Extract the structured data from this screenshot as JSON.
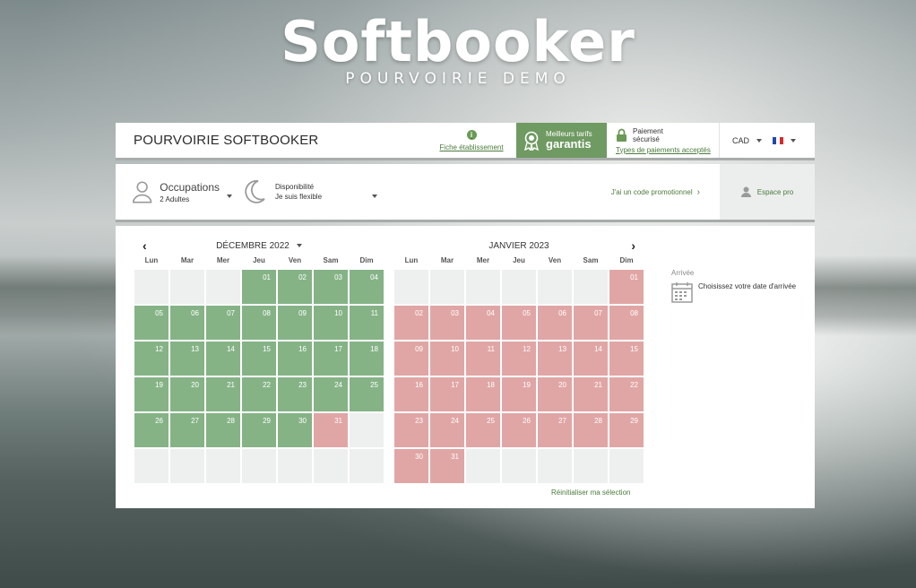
{
  "logo": {
    "title": "Softbooker",
    "subtitle": "POURVOIRIE DEMO"
  },
  "header": {
    "brand": "POURVOIRIE SOFTBOOKER",
    "fiche_link": "Fiche établissement",
    "badge_line1": "Meilleurs tarifs",
    "badge_line2": "garantis",
    "paiement_line1": "Paiement",
    "paiement_line2": "sécurisé",
    "paiement_link": "Types de paiements acceptés",
    "currency": "CAD"
  },
  "search": {
    "occupations_label": "Occupations",
    "occupations_value": "2 Adultes",
    "dispo_label": "Disponibilité",
    "dispo_value": "Je suis flexible",
    "promo_link": "J'ai un code promotionnel",
    "espace_pro": "Espace pro"
  },
  "calendar": {
    "months": [
      {
        "title": "DÉCEMBRE 2022",
        "weekdays": [
          "Lun",
          "Mar",
          "Mer",
          "Jeu",
          "Ven",
          "Sam",
          "Dim"
        ],
        "cells": [
          {
            "d": "",
            "s": "e"
          },
          {
            "d": "",
            "s": "e"
          },
          {
            "d": "",
            "s": "e"
          },
          {
            "d": "01",
            "s": "g"
          },
          {
            "d": "02",
            "s": "g"
          },
          {
            "d": "03",
            "s": "g"
          },
          {
            "d": "04",
            "s": "g"
          },
          {
            "d": "05",
            "s": "g"
          },
          {
            "d": "06",
            "s": "g"
          },
          {
            "d": "07",
            "s": "g"
          },
          {
            "d": "08",
            "s": "g"
          },
          {
            "d": "09",
            "s": "g"
          },
          {
            "d": "10",
            "s": "g"
          },
          {
            "d": "11",
            "s": "g"
          },
          {
            "d": "12",
            "s": "g"
          },
          {
            "d": "13",
            "s": "g"
          },
          {
            "d": "14",
            "s": "g"
          },
          {
            "d": "15",
            "s": "g"
          },
          {
            "d": "16",
            "s": "g"
          },
          {
            "d": "17",
            "s": "g"
          },
          {
            "d": "18",
            "s": "g"
          },
          {
            "d": "19",
            "s": "g"
          },
          {
            "d": "20",
            "s": "g"
          },
          {
            "d": "21",
            "s": "g"
          },
          {
            "d": "22",
            "s": "g"
          },
          {
            "d": "23",
            "s": "g"
          },
          {
            "d": "24",
            "s": "g"
          },
          {
            "d": "25",
            "s": "g"
          },
          {
            "d": "26",
            "s": "g"
          },
          {
            "d": "27",
            "s": "g"
          },
          {
            "d": "28",
            "s": "g"
          },
          {
            "d": "29",
            "s": "g"
          },
          {
            "d": "30",
            "s": "g"
          },
          {
            "d": "31",
            "s": "r"
          },
          {
            "d": "",
            "s": "e"
          },
          {
            "d": "",
            "s": "e"
          },
          {
            "d": "",
            "s": "e"
          },
          {
            "d": "",
            "s": "e"
          },
          {
            "d": "",
            "s": "e"
          },
          {
            "d": "",
            "s": "e"
          },
          {
            "d": "",
            "s": "e"
          },
          {
            "d": "",
            "s": "e"
          }
        ]
      },
      {
        "title": "JANVIER 2023",
        "weekdays": [
          "Lun",
          "Mar",
          "Mer",
          "Jeu",
          "Ven",
          "Sam",
          "Dim"
        ],
        "cells": [
          {
            "d": "",
            "s": "e"
          },
          {
            "d": "",
            "s": "e"
          },
          {
            "d": "",
            "s": "e"
          },
          {
            "d": "",
            "s": "e"
          },
          {
            "d": "",
            "s": "e"
          },
          {
            "d": "",
            "s": "e"
          },
          {
            "d": "01",
            "s": "r"
          },
          {
            "d": "02",
            "s": "r"
          },
          {
            "d": "03",
            "s": "r"
          },
          {
            "d": "04",
            "s": "r"
          },
          {
            "d": "05",
            "s": "r"
          },
          {
            "d": "06",
            "s": "r"
          },
          {
            "d": "07",
            "s": "r"
          },
          {
            "d": "08",
            "s": "r"
          },
          {
            "d": "09",
            "s": "r"
          },
          {
            "d": "10",
            "s": "r"
          },
          {
            "d": "11",
            "s": "r"
          },
          {
            "d": "12",
            "s": "r"
          },
          {
            "d": "13",
            "s": "r"
          },
          {
            "d": "14",
            "s": "r"
          },
          {
            "d": "15",
            "s": "r"
          },
          {
            "d": "16",
            "s": "r"
          },
          {
            "d": "17",
            "s": "r"
          },
          {
            "d": "18",
            "s": "r"
          },
          {
            "d": "19",
            "s": "r"
          },
          {
            "d": "20",
            "s": "r"
          },
          {
            "d": "21",
            "s": "r"
          },
          {
            "d": "22",
            "s": "r"
          },
          {
            "d": "23",
            "s": "r"
          },
          {
            "d": "24",
            "s": "r"
          },
          {
            "d": "25",
            "s": "r"
          },
          {
            "d": "26",
            "s": "r"
          },
          {
            "d": "27",
            "s": "r"
          },
          {
            "d": "28",
            "s": "r"
          },
          {
            "d": "29",
            "s": "r"
          },
          {
            "d": "30",
            "s": "r"
          },
          {
            "d": "31",
            "s": "r"
          },
          {
            "d": "",
            "s": "e"
          },
          {
            "d": "",
            "s": "e"
          },
          {
            "d": "",
            "s": "e"
          },
          {
            "d": "",
            "s": "e"
          },
          {
            "d": "",
            "s": "e"
          }
        ]
      }
    ],
    "reset": "Réinitialiser ma sélection",
    "arrivee_label": "Arrivée",
    "arrivee_text": "Choisissez votre date d'arrivée"
  },
  "colors": {
    "available": "#85b386",
    "unavailable": "#e0a6a5",
    "accent": "#6f9a62",
    "link": "#4c7a3d"
  },
  "icons": [
    "info-icon",
    "medal-icon",
    "lock-icon",
    "flag-icon",
    "person-icon",
    "moon-icon",
    "user-icon",
    "calendar-icon",
    "chevron-left-icon",
    "chevron-right-icon"
  ]
}
